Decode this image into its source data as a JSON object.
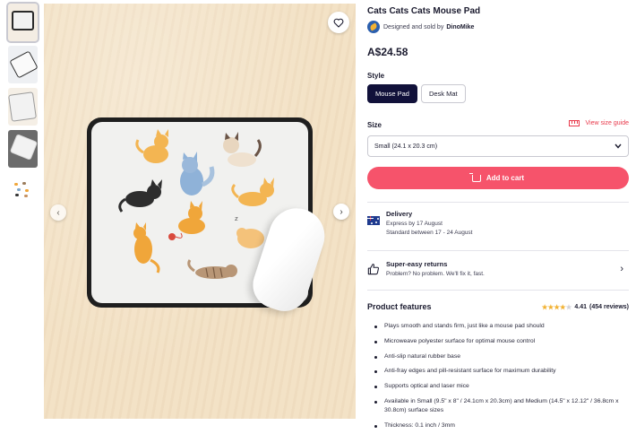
{
  "product": {
    "title": "Cats Cats Cats Mouse Pad",
    "seller_prefix": "Designed and sold by",
    "seller_name": "DinoMike",
    "price": "A$24.58"
  },
  "style": {
    "label": "Style",
    "options": [
      "Mouse Pad",
      "Desk Mat"
    ],
    "selected": "Mouse Pad"
  },
  "size": {
    "label": "Size",
    "guide_link": "View size guide",
    "selected": "Small (24.1 x 20.3 cm)"
  },
  "cart": {
    "label": "Add to cart"
  },
  "delivery": {
    "title": "Delivery",
    "express": "Express by 17 August",
    "standard": "Standard between 17 - 24 August"
  },
  "returns": {
    "title": "Super-easy returns",
    "subtitle": "Problem? No problem. We'll fix it, fast."
  },
  "features": {
    "title": "Product features",
    "rating_value": "4.41",
    "rating_count": "(454 reviews)",
    "rating_stars": 4.41,
    "items": [
      "Plays smooth and stands firm, just like a mouse pad should",
      "Microweave polyester surface for optimal mouse control",
      "Anti-slip natural rubber base",
      "Anti-fray edges and pill-resistant surface for maximum durability",
      "Supports optical and laser mice",
      "Available in Small (9.5\" x 8\" / 24.1cm x 20.3cm) and Medium (14.5\" x 12.12\" / 36.8cm x 30.8cm) surface sizes",
      "Thickness: 0.1 inch / 3mm"
    ]
  },
  "icons": {
    "favorite": "heart-icon",
    "prev": "chevron-left-icon",
    "next": "chevron-right-icon",
    "size_guide": "ruler-icon",
    "cart": "cart-icon",
    "delivery": "australia-flag-icon",
    "returns": "thumbs-up-icon",
    "returns_chevron": "chevron-right-icon",
    "select_chevron": "chevron-down-icon"
  },
  "colors": {
    "accent": "#f6536b",
    "selected_chip": "#11113a",
    "link": "#e8394b",
    "star": "#f2b233"
  }
}
